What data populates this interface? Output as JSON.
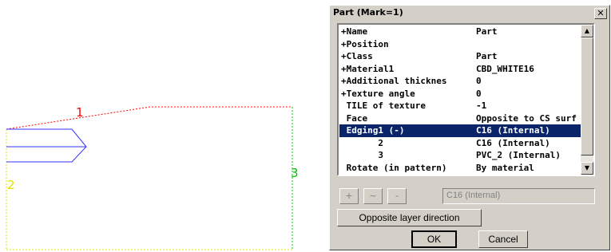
{
  "canvas": {
    "edge_labels": [
      "1",
      "2",
      "3"
    ],
    "colors": {
      "top_edge": "#ff0000",
      "left_edge": "#e0e000",
      "right_edge": "#00c000",
      "shape": "#3333ff",
      "bottom_edge": "#e0e000"
    }
  },
  "dialog": {
    "title": "Part (Mark=1)",
    "close_icon": "close-icon",
    "properties": [
      {
        "key": "+Name",
        "value": "Part"
      },
      {
        "key": "+Position",
        "value": ""
      },
      {
        "key": "+Class",
        "value": "Part"
      },
      {
        "key": "+Material1",
        "value": "CBD_WHITE16"
      },
      {
        "key": "+Additional thicknes",
        "value": "0"
      },
      {
        "key": "+Texture angle",
        "value": "0"
      },
      {
        "key": " TILE of texture",
        "value": "-1"
      },
      {
        "key": " Face",
        "value": "Opposite to CS surf"
      },
      {
        "key": " Edging1 (-)",
        "value": "C16 (Internal)",
        "selected": true
      },
      {
        "key": "       2",
        "value": "C16 (Internal)"
      },
      {
        "key": "       3",
        "value": "PVC_2 (Internal)"
      },
      {
        "key": " Rotate (in pattern)",
        "value": "By material"
      }
    ],
    "tool_buttons": [
      "+",
      "~",
      "-"
    ],
    "edit_value": "C16 (Internal)",
    "opposite_button": "Opposite layer direction",
    "ok_button": "OK",
    "cancel_button": "Cancel",
    "selection_color": "#0a246a"
  }
}
